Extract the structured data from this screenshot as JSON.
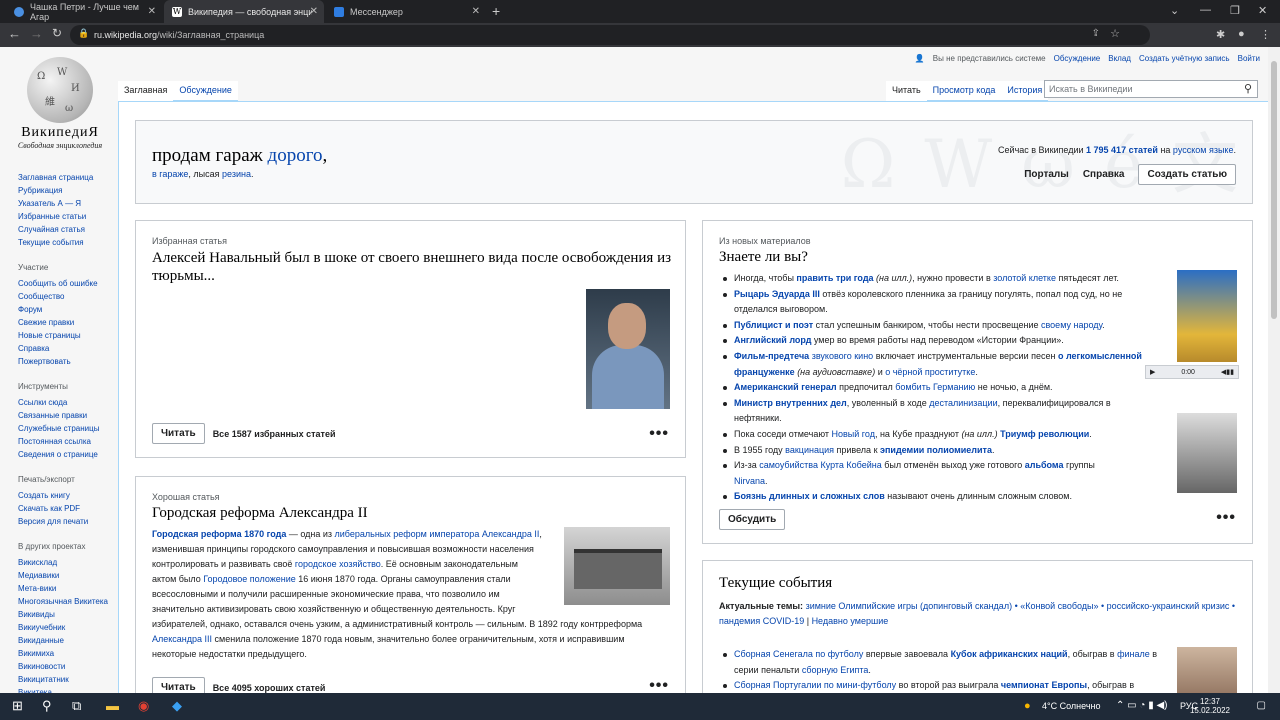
{
  "browser": {
    "tabs": [
      {
        "title": "Чашка Петри - Лучше чем Агар",
        "icon_color": "#4a90e2"
      },
      {
        "title": "Википедия — свободная энцик",
        "icon_color": "#ffffff"
      },
      {
        "title": "Мессенджер",
        "icon_color": "#2f7de1"
      }
    ],
    "url_host": "ru.wikipedia.org",
    "url_path": "/wiki/Заглавная_страница"
  },
  "logo": {
    "wordmark": "ВикипедиЯ",
    "tagline": "Свободная энциклопедия"
  },
  "personal": {
    "not_logged": "Вы не представились системе",
    "talk": "Обсуждение",
    "contrib": "Вклад",
    "create_account": "Создать учётную запись",
    "login": "Войти"
  },
  "page_tabs": {
    "main": "Заглавная",
    "talk": "Обсуждение",
    "read": "Читать",
    "view_source": "Просмотр кода",
    "history": "История"
  },
  "search": {
    "placeholder": "Искать в Википедии"
  },
  "sidebar": {
    "nav": [
      "Заглавная страница",
      "Рубрикация",
      "Указатель А — Я",
      "Избранные статьи",
      "Случайная статья",
      "Текущие события"
    ],
    "participation_title": "Участие",
    "participation": [
      "Сообщить об ошибке",
      "Сообщество",
      "Форум",
      "Свежие правки",
      "Новые страницы",
      "Справка",
      "Пожертвовать"
    ],
    "tools_title": "Инструменты",
    "tools": [
      "Ссылки сюда",
      "Связанные правки",
      "Служебные страницы",
      "Постоянная ссылка",
      "Сведения о странице"
    ],
    "print_title": "Печать/экспорт",
    "print": [
      "Создать книгу",
      "Скачать как PDF",
      "Версия для печати"
    ],
    "projects_title": "В других проектах",
    "projects": [
      "Викисклад",
      "Медиавики",
      "Мета-вики",
      "Многоязычная Викитека",
      "Викиви­ды",
      "Викиучебник",
      "Викиданные",
      "Викимиха",
      "Викиновости",
      "Викицитатник",
      "Викитека"
    ]
  },
  "banner": {
    "heading_plain": "продам гараж ",
    "heading_link": "дорого",
    "heading_comma": ",",
    "sub_link1": "в гараже",
    "sub_mid": ", лысая ",
    "sub_link2": "резина",
    "sub_end": ".",
    "stat_pre": "Сейчас в Википедии ",
    "stat_count": "1 795 417 статей",
    "stat_mid": " на ",
    "stat_lang": "русском языке",
    "stat_end": ".",
    "portals": "Порталы",
    "help": "Справка",
    "create": "Создать статью"
  },
  "featured": {
    "kicker": "Избранная статья",
    "title": "Алексей Навальный был в шоке от своего внешнего вида после освобождения из тюрьмы...",
    "read": "Читать",
    "all": "Все 1587 избранных статей"
  },
  "good": {
    "kicker": "Хорошая статья",
    "title": "Городская реформа Александра II",
    "lines": [
      [
        "Городская реформа 1870 года",
        " — одна из ",
        "либеральных реформ императора Александра II",
        ","
      ],
      [
        "изменившая принципы городского самоуправления и повысившая возможности населения"
      ],
      [
        "контролировать и развивать своё ",
        "городское хозяйство",
        ". Её основным законодательным"
      ],
      [
        "актом было ",
        "Городовое положение",
        " 16 июня 1870 года. Органы самоуправления стали"
      ],
      [
        "всесословными и получили расширенные экономические права, что позволило им"
      ],
      [
        "значительно активизировать свою хозяйственную и общественную деятельность. Круг"
      ],
      [
        "избирателей, однако, оставался очень узким, а административный контроль — сильным. В 1892 году контрреформа"
      ],
      [
        "Александра III",
        " сменила положение 1870 года новым, значительно более ограничительным, хотя и исправившим"
      ],
      [
        "некоторые недостатки предыдущего."
      ]
    ],
    "read": "Читать",
    "all": "Все 4095 хороших статей"
  },
  "dyk": {
    "kicker": "Из новых материалов",
    "title": "Знаете ли вы?",
    "items": [
      {
        "t": [
          [
            "",
            "Иногда, чтобы "
          ],
          [
            "b",
            "править три года"
          ],
          [
            "i",
            " (на илл.)"
          ],
          [
            "",
            ", нужно провести в "
          ],
          [
            "l",
            "золотой клетке"
          ],
          [
            "",
            " пятьдесят лет."
          ]
        ]
      },
      {
        "t": [
          [
            "b",
            "Рыцарь Эдуарда III"
          ],
          [
            "",
            " отвёз королевского пленника за границу погулять, попал под суд, но не отделался выговором."
          ]
        ]
      },
      {
        "t": [
          [
            "b",
            "Публицист и поэт"
          ],
          [
            "",
            " стал успешным банкиром, чтобы нести просвещение "
          ],
          [
            "l",
            "своему народу"
          ],
          [
            "",
            "."
          ]
        ]
      },
      {
        "t": [
          [
            "b",
            "Английский лорд"
          ],
          [
            "",
            " умер во время работы над переводом «Истории Франции»."
          ]
        ]
      },
      {
        "t": [
          [
            "b",
            "Фильм-предтеча"
          ],
          [
            "",
            " "
          ],
          [
            "l",
            "звукового кино"
          ],
          [
            "",
            " включает инструментальные версии песен "
          ],
          [
            "b",
            "о легкомысленной француженке"
          ],
          [
            "i",
            " (на аудиовставке)"
          ],
          [
            "",
            " и "
          ],
          [
            "l",
            "о чёрной проститутке"
          ],
          [
            "",
            "."
          ]
        ]
      },
      {
        "t": [
          [
            "b",
            "Американский генерал"
          ],
          [
            "",
            " предпочитал "
          ],
          [
            "l",
            "бомбить Германию"
          ],
          [
            "",
            " не ночью, а днём."
          ]
        ]
      },
      {
        "t": [
          [
            "b",
            "Министр внутренних дел"
          ],
          [
            "",
            ", уволенный в ходе "
          ],
          [
            "l",
            "десталинизации"
          ],
          [
            "",
            ", переквалифицировался в нефтяники."
          ]
        ]
      },
      {
        "t": [
          [
            "",
            "Пока соседи отмечают "
          ],
          [
            "l",
            "Новый год"
          ],
          [
            "",
            ", на Кубе празднуют "
          ],
          [
            "i",
            "(на илл.)"
          ],
          [
            "",
            " "
          ],
          [
            "b",
            "Триумф революции"
          ],
          [
            "",
            "."
          ]
        ]
      },
      {
        "t": [
          [
            "",
            "В 1955 году "
          ],
          [
            "l",
            "вакцинация"
          ],
          [
            "",
            " привела к "
          ],
          [
            "b",
            "эпидемии полиомиелита"
          ],
          [
            "",
            "."
          ]
        ]
      },
      {
        "t": [
          [
            "",
            "Из-за "
          ],
          [
            "l",
            "самоубийства Курта Кобейна"
          ],
          [
            "",
            " был отменён выход уже готового "
          ],
          [
            "b",
            "альбома"
          ],
          [
            "",
            " группы "
          ],
          [
            "l",
            "Nirvana"
          ],
          [
            "",
            "."
          ]
        ]
      },
      {
        "t": [
          [
            "b",
            "Боязнь длинных и сложных слов"
          ],
          [
            "",
            " называют очень длинным сложным словом."
          ]
        ]
      }
    ],
    "audio_time": "0:00",
    "discuss": "Обсудить"
  },
  "events": {
    "title": "Текущие события",
    "topics_label": "Актуальные темы:",
    "topics": "зимние Олимпийские игры (допинговый скандал) • «Конвой свободы» • российско-украинский кризис • пандемия COVID-19",
    "recent": "Недавно умершие",
    "items": [
      [
        [
          "l",
          "Сборная Сенегала по футболу"
        ],
        [
          "",
          " впервые завоевала "
        ],
        [
          "b",
          "Кубок африканских наций"
        ],
        [
          "",
          ", обыграв в "
        ],
        [
          "l",
          "финале"
        ],
        [
          "",
          " в серии пенальти "
        ],
        [
          "l",
          "сборную Египта"
        ],
        [
          "",
          "."
        ]
      ],
      [
        [
          "l",
          "Сборная Португалии по мини-футболу"
        ],
        [
          "",
          " во второй раз выиграла "
        ],
        [
          "b",
          "чемпионат Европы"
        ],
        [
          "",
          ", обыграв в финале "
        ],
        [
          "l",
          "сборную России"
        ],
        [
          "",
          "."
        ]
      ]
    ]
  },
  "taskbar": {
    "weather": "4°C Солнечно",
    "lang": "РУС",
    "time": "12:37",
    "date": "15.02.2022"
  }
}
